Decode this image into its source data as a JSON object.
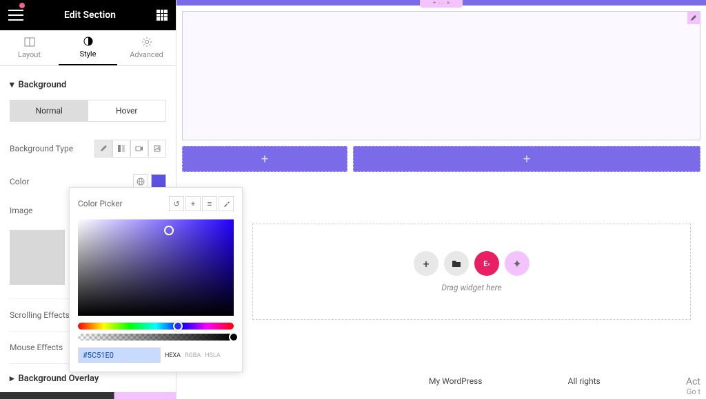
{
  "header": {
    "title": "Edit Section"
  },
  "tabs": {
    "layout": "Layout",
    "style": "Style",
    "advanced": "Advanced"
  },
  "panel": {
    "background_heading": "Background",
    "normal": "Normal",
    "hover": "Hover",
    "bg_type_label": "Background Type",
    "color_label": "Color",
    "image_label": "Image",
    "scrolling_effects": "Scrolling Effects",
    "mouse_effects": "Mouse Effects",
    "bg_overlay_heading": "Background Overlay"
  },
  "picker": {
    "title": "Color Picker",
    "hex_value": "#5C51E0",
    "fmt_hexa": "HEXA",
    "fmt_rgba": "RGBA",
    "fmt_hsla": "HSLA"
  },
  "canvas": {
    "drag_hint": "Drag widget here",
    "plus": "+",
    "ek_label": "E‹"
  },
  "footer": {
    "site_name": "My WordPress",
    "rights": "All rights",
    "activate": "Act",
    "activate_sub": "Go t"
  },
  "colors": {
    "accent": "#7C6BE8",
    "selected": "#5C51E0",
    "pink": "#EA1E63",
    "lavender": "#f3c2ff"
  }
}
